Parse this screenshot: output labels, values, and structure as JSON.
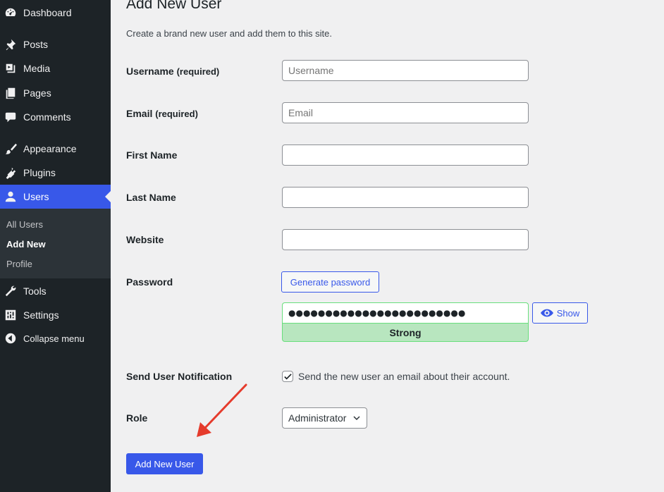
{
  "sidebar": {
    "items": [
      {
        "label": "Dashboard",
        "icon": "dashboard-icon"
      },
      {
        "label": "Posts",
        "icon": "pin-icon"
      },
      {
        "label": "Media",
        "icon": "media-icon"
      },
      {
        "label": "Pages",
        "icon": "pages-icon"
      },
      {
        "label": "Comments",
        "icon": "comment-icon"
      },
      {
        "label": "Appearance",
        "icon": "brush-icon"
      },
      {
        "label": "Plugins",
        "icon": "plug-icon"
      },
      {
        "label": "Users",
        "icon": "user-icon"
      },
      {
        "label": "Tools",
        "icon": "wrench-icon"
      },
      {
        "label": "Settings",
        "icon": "settings-icon"
      },
      {
        "label": "Collapse menu",
        "icon": "collapse-icon"
      }
    ],
    "submenu": [
      "All Users",
      "Add New",
      "Profile"
    ],
    "active_color": "#3858e9"
  },
  "page": {
    "title": "Add New User",
    "description": "Create a brand new user and add them to this site."
  },
  "form": {
    "username_label": "Username",
    "username_req": "(required)",
    "username_placeholder": "Username",
    "email_label": "Email",
    "email_req": "(required)",
    "email_placeholder": "Email",
    "first_name_label": "First Name",
    "last_name_label": "Last Name",
    "website_label": "Website",
    "password_label": "Password",
    "generate_password": "Generate password",
    "password_value": "●●●●●●●●●●●●●●●●●●●●●●●●",
    "show_label": "Show",
    "strength": "Strong",
    "notification_label": "Send User Notification",
    "notification_text": "Send the new user an email about their account.",
    "notification_checked": true,
    "role_label": "Role",
    "role_value": "Administrator",
    "submit_label": "Add New User"
  },
  "colors": {
    "accent": "#3858e9",
    "strength_bg": "#b8e6bf",
    "annotation_arrow": "#e53b2c"
  }
}
